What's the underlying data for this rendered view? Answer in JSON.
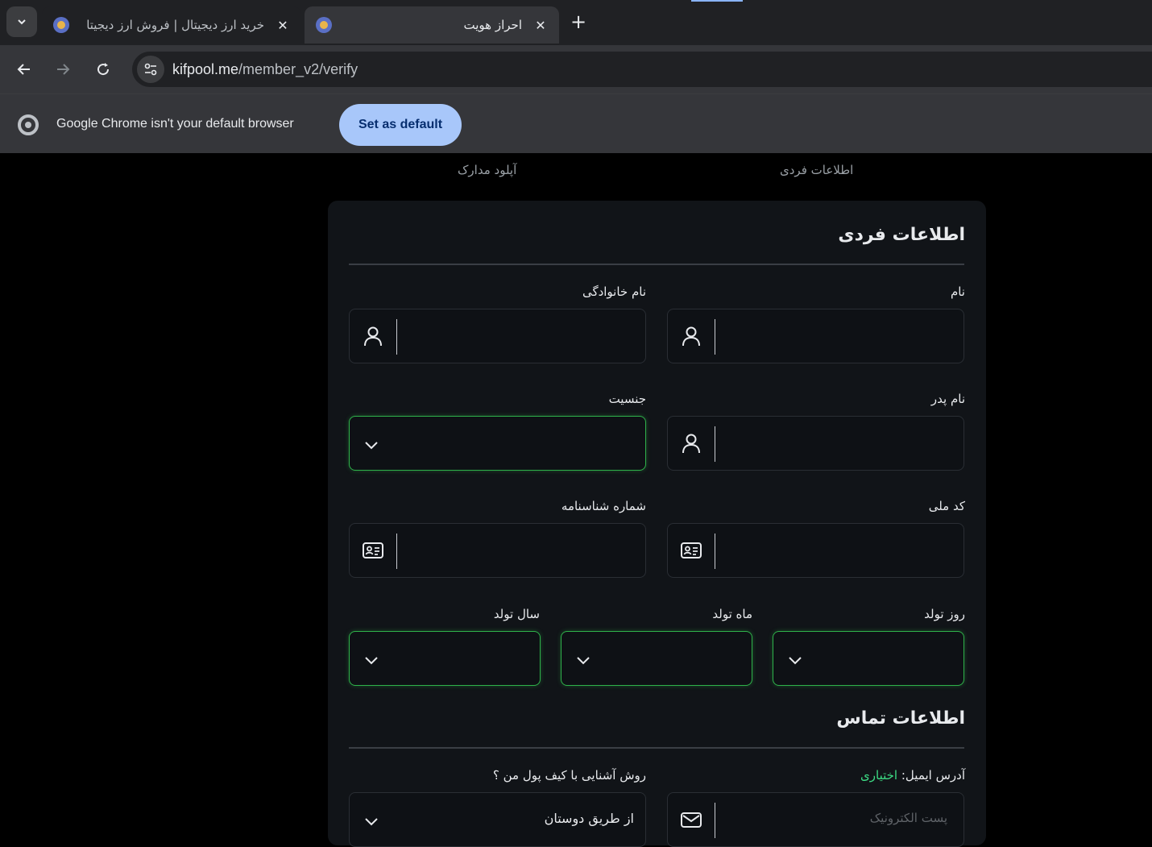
{
  "browser": {
    "tabs": [
      {
        "title": "خرید ارز دیجیتال | فروش ارز دیجیتا",
        "active": false
      },
      {
        "title": "احراز هویت",
        "active": true
      }
    ],
    "url_host": "kifpool.me",
    "url_path": "/member_v2/verify",
    "infobar": {
      "message": "Google Chrome isn't your default browser",
      "button": "Set as default"
    }
  },
  "steps": {
    "personal": "اطلاعات فردی",
    "upload": "آپلود مدارک"
  },
  "personal": {
    "title": "اطلاعات فردی",
    "first_name_label": "نام",
    "last_name_label": "نام خانوادگی",
    "father_name_label": "نام پدر",
    "gender_label": "جنسیت",
    "national_code_label": "کد ملی",
    "id_number_label": "شماره شناسنامه",
    "birth_day_label": "روز تولد",
    "birth_month_label": "ماه تولد",
    "birth_year_label": "سال تولد"
  },
  "contact": {
    "title": "اطلاعات تماس",
    "email_label": "آدرس ایمیل:",
    "email_optional": "اختیاری",
    "email_placeholder": "پست الکترونیک",
    "referral_label": "روش آشنایی با کیف پول من ؟",
    "referral_value": "از طریق دوستان"
  },
  "colors": {
    "accent_green": "#2fb24a",
    "optional_green": "#3ddc84",
    "card_bg": "#111418",
    "chrome_button": "#a8c7fa"
  }
}
